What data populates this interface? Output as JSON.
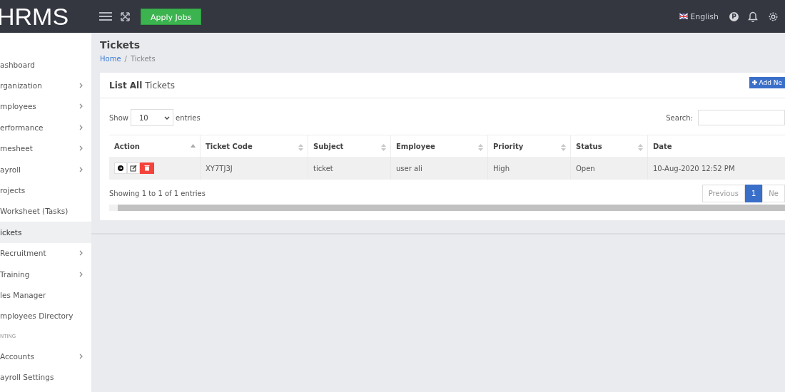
{
  "topbar": {
    "logo": "HRMS",
    "apply_button": "Apply Jobs",
    "language": "English",
    "avatar_letter": "P"
  },
  "sidebar": {
    "items": [
      {
        "kind": "link",
        "label": "ashboard",
        "expandable": false,
        "selected": false
      },
      {
        "kind": "link",
        "label": "rganization",
        "expandable": true,
        "selected": false
      },
      {
        "kind": "link",
        "label": "mployees",
        "expandable": true,
        "selected": false
      },
      {
        "kind": "link",
        "label": "erformance",
        "expandable": true,
        "selected": false
      },
      {
        "kind": "link",
        "label": "mesheet",
        "expandable": true,
        "selected": false
      },
      {
        "kind": "link",
        "label": "ayroll",
        "expandable": true,
        "selected": false
      },
      {
        "kind": "link",
        "label": "rojects",
        "expandable": false,
        "selected": false
      },
      {
        "kind": "link",
        "label": "Worksheet (Tasks)",
        "expandable": false,
        "selected": false
      },
      {
        "kind": "link",
        "label": "ickets",
        "expandable": false,
        "selected": true
      },
      {
        "kind": "link",
        "label": "Recruitment",
        "expandable": true,
        "selected": false
      },
      {
        "kind": "link",
        "label": "Training",
        "expandable": true,
        "selected": false
      },
      {
        "kind": "link",
        "label": "les Manager",
        "expandable": false,
        "selected": false
      },
      {
        "kind": "link",
        "label": "mployees Directory",
        "expandable": false,
        "selected": false
      },
      {
        "kind": "section",
        "label": "NTING"
      },
      {
        "kind": "link",
        "label": "Accounts",
        "expandable": true,
        "selected": false
      },
      {
        "kind": "link",
        "label": "ayroll Settings",
        "expandable": false,
        "selected": false
      }
    ]
  },
  "page": {
    "title": "Tickets",
    "breadcrumb_separator": "/",
    "breadcrumb": [
      {
        "label": "Home",
        "link": true
      },
      {
        "label": "Tickets",
        "link": false
      }
    ]
  },
  "card": {
    "title_bold": "List All",
    "title_rest": "Tickets",
    "add_button": "Add Ne",
    "show_label": "Show",
    "entries_value": "10",
    "entries_label": "entries",
    "search_label": "Search:",
    "table": {
      "columns": [
        {
          "label": "Action",
          "sortable": true,
          "sorted": true
        },
        {
          "label": "Ticket Code",
          "sortable": true,
          "sorted": false
        },
        {
          "label": "Subject",
          "sortable": true,
          "sorted": false
        },
        {
          "label": "Employee",
          "sortable": true,
          "sorted": false
        },
        {
          "label": "Priority",
          "sortable": true,
          "sorted": false
        },
        {
          "label": "Status",
          "sortable": true,
          "sorted": false
        },
        {
          "label": "Date",
          "sortable": false,
          "sorted": false
        }
      ],
      "rows": [
        {
          "cells": [
            "",
            "XY7TJ3J",
            "ticket",
            "user ali",
            "High",
            "Open",
            "10-Aug-2020 12:52 PM"
          ]
        }
      ]
    },
    "info": "Showing 1 to 1 of 1 entries",
    "pagination": [
      {
        "label": "Previous",
        "selected": false
      },
      {
        "label": "1",
        "selected": true
      },
      {
        "label": "Ne",
        "selected": false
      }
    ]
  }
}
